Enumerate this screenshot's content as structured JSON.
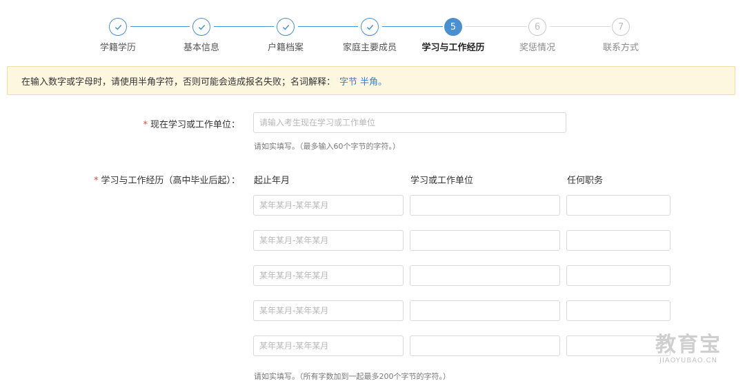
{
  "stepper": {
    "steps": [
      {
        "label": "学籍学历",
        "status": "done",
        "number": "1"
      },
      {
        "label": "基本信息",
        "status": "done",
        "number": "2"
      },
      {
        "label": "户籍档案",
        "status": "done",
        "number": "3"
      },
      {
        "label": "家庭主要成员",
        "status": "done",
        "number": "4"
      },
      {
        "label": "学习与工作经历",
        "status": "active",
        "number": "5"
      },
      {
        "label": "奖惩情况",
        "status": "todo",
        "number": "6"
      },
      {
        "label": "联系方式",
        "status": "todo",
        "number": "7"
      }
    ],
    "accent_color": "#4a8fd0"
  },
  "notice": {
    "text": "在输入数字或字母时，请使用半角字符，否则可能会造成报名失败；名词解释：",
    "link1": "字节",
    "link2": "半角。"
  },
  "form": {
    "required_mark": "*",
    "current_unit": {
      "label": "现在学习或工作单位：",
      "placeholder": "请输入考生现在学习或工作单位",
      "value": "",
      "hint": "请如实填写。（最多输入60个字节的字符。）"
    },
    "experience": {
      "label": "学习与工作经历（高中毕业后起）：",
      "columns": {
        "period": "起止年月",
        "unit": "学习或工作单位",
        "position": "任何职务"
      },
      "rows": [
        {
          "period_placeholder": "某年某月-某年某月",
          "unit": "",
          "position": ""
        },
        {
          "period_placeholder": "某年某月-某年某月",
          "unit": "",
          "position": ""
        },
        {
          "period_placeholder": "某年某月-某年某月",
          "unit": "",
          "position": ""
        },
        {
          "period_placeholder": "某年某月-某年某月",
          "unit": "",
          "position": ""
        },
        {
          "period_placeholder": "某年某月-某年某月",
          "unit": "",
          "position": ""
        }
      ],
      "hint": "请如实填写。（所有字数加到一起最多200个字节的字符。）"
    }
  },
  "watermark": {
    "cn": "教育宝",
    "en": "JIAOYUBAO.CN"
  }
}
